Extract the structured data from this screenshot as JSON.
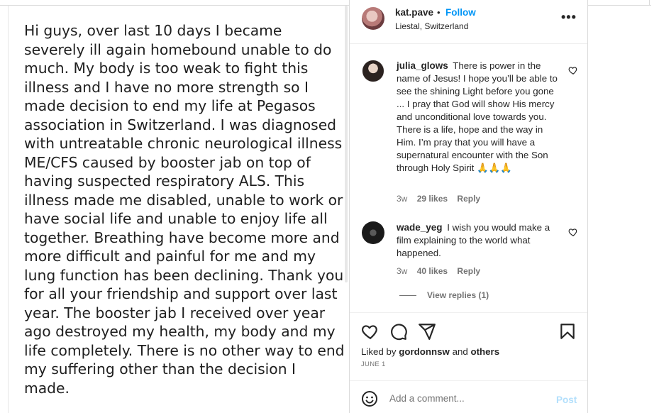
{
  "post_image": {
    "text": "Hi guys, over last 10 days I became severely ill again homebound unable to do much. My body is too weak to fight this illness and I have no more strength so I made decision to end my life at Pegasos association in Switzerland. I was diagnosed with untreatable chronic neurological illness ME/CFS caused by booster jab on top of having suspected respiratory ALS. This illness made me disabled, unable to work or have social life and unable to enjoy life all together. Breathing have become more and more difficult and painful for me and my lung function has been declining. Thank you for all your friendship and support over last year. The booster jab I received over year ago destroyed my health, my body and my life completely. There is no other way to end my suffering other than the decision I made."
  },
  "header": {
    "username": "kat.pave",
    "separator": "•",
    "follow_label": "Follow",
    "location": "Liestal, Switzerland",
    "more_label": "•••"
  },
  "comments": [
    {
      "username": "julia_glows",
      "text": "There is power in the name of Jesus! I hope you’ll be able to see the shining Light before you gone ... I pray that God will show His mercy and unconditional love towards you. There is a life, hope and the way in Him. I’m pray that you will have a supernatural encounter with the Son through Holy Spirit 🙏🙏🙏",
      "age": "3w",
      "likes": "29 likes",
      "reply_label": "Reply"
    },
    {
      "username": "wade_yeg",
      "text": "I wish you would make a film explaining to the world what happened.",
      "age": "3w",
      "likes": "40 likes",
      "reply_label": "Reply"
    }
  ],
  "view_replies": "View replies (1)",
  "likes_line": {
    "prefix": "Liked by",
    "user": "gordonnsw",
    "middle": "and",
    "suffix": "others"
  },
  "date": "JUNE 1",
  "add_comment": {
    "placeholder": "Add a comment...",
    "post_label": "Post"
  },
  "icons": [
    "heart-icon",
    "comment-icon",
    "share-icon",
    "bookmark-icon",
    "emoji-icon",
    "more-icon"
  ]
}
